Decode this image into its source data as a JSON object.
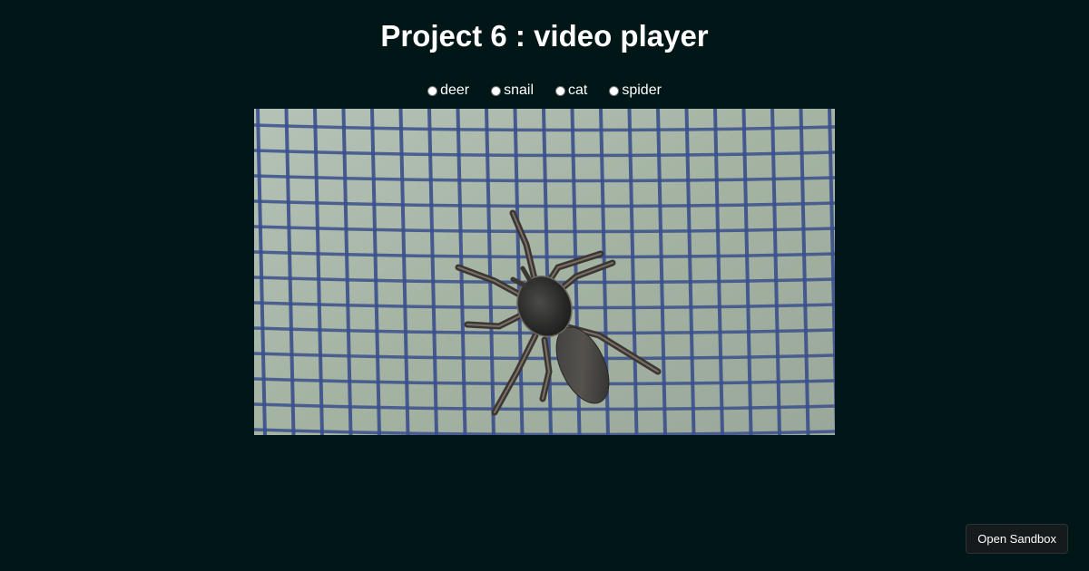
{
  "header": {
    "title": "Project 6 : video player"
  },
  "video_selector": {
    "options": [
      {
        "label": "deer",
        "selected": false
      },
      {
        "label": "snail",
        "selected": false
      },
      {
        "label": "cat",
        "selected": false
      },
      {
        "label": "spider",
        "selected": false
      }
    ]
  },
  "video": {
    "subject": "spider on window screen mesh"
  },
  "footer": {
    "sandbox_button_label": "Open Sandbox"
  },
  "colors": {
    "background": "#011617",
    "text": "#ffffff",
    "mesh_background": "#a3b0a4",
    "mesh_lines": "#3a4f8c",
    "sandbox_button_bg": "#151a1c"
  }
}
